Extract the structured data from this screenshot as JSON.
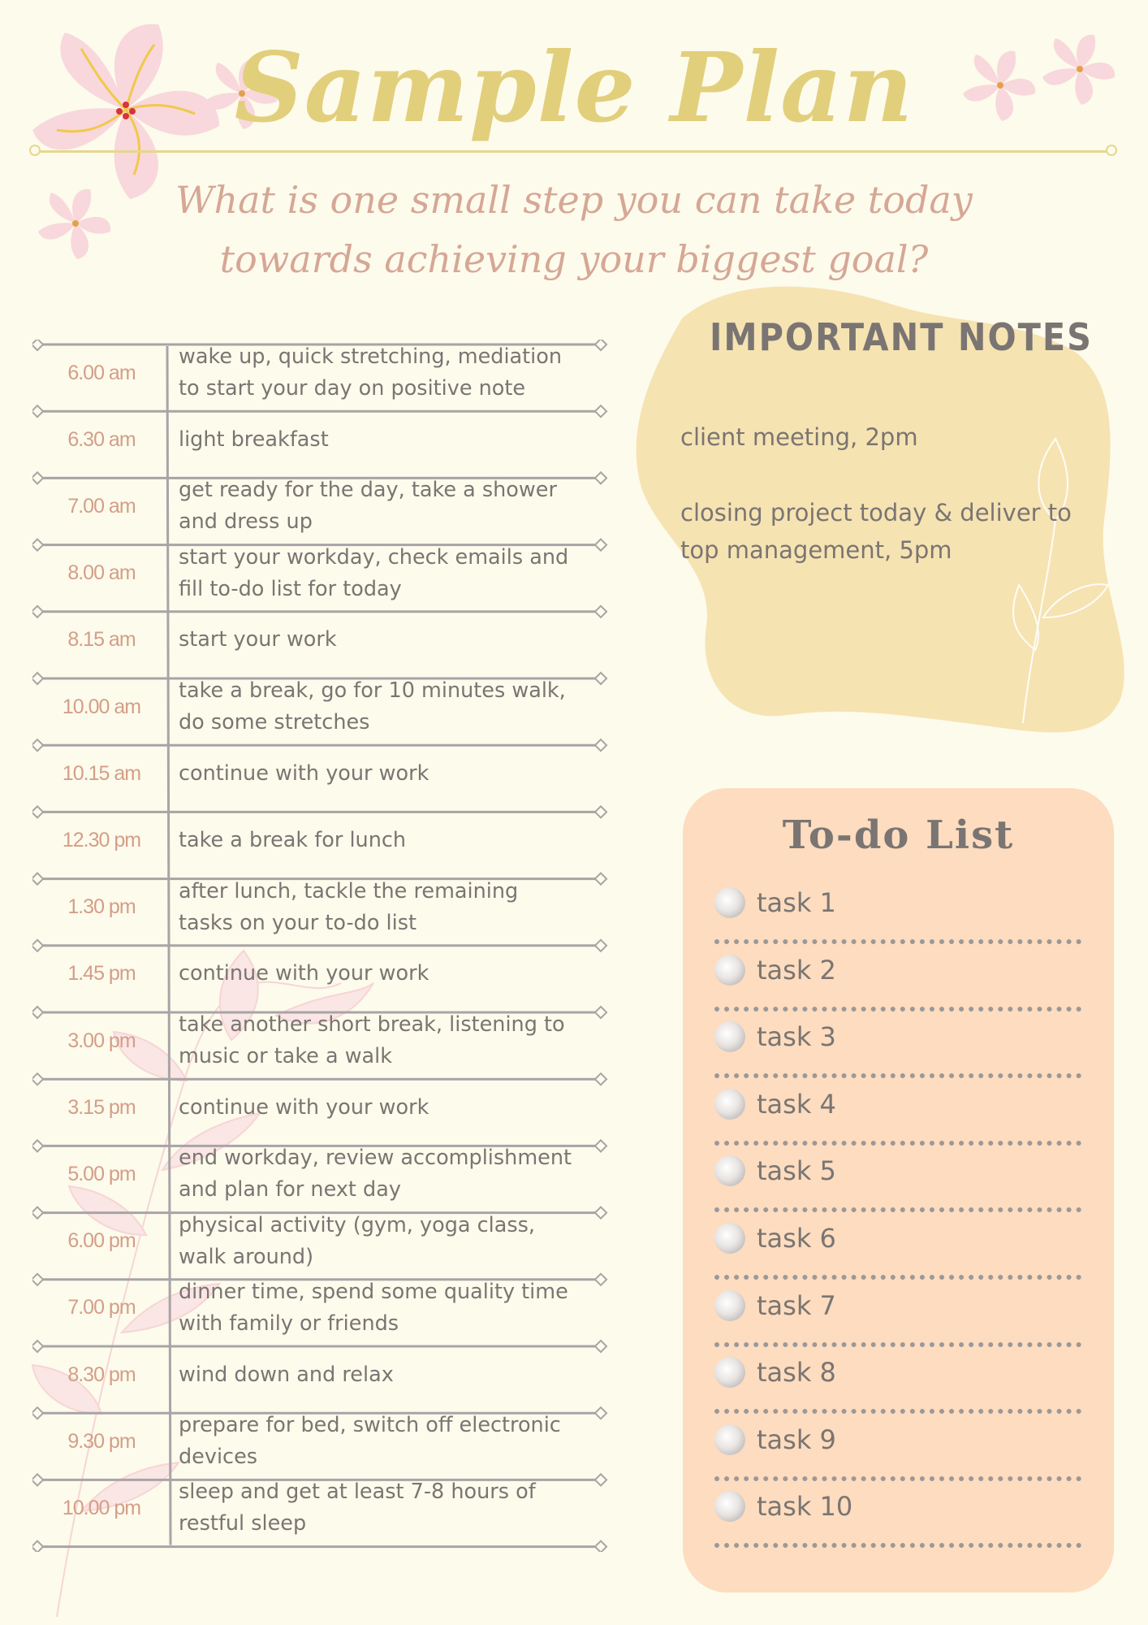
{
  "page": {
    "title": "Sample Plan",
    "question": "What is one small step you can take today towards achieving your biggest goal?"
  },
  "colors": {
    "background": "#fdfbec",
    "title": "#e2cf7c",
    "question": "#d6a796",
    "time": "#d49e88",
    "body_text": "#7a7572",
    "notes_blob": "#f6e3b2",
    "todo_card": "#fddcbf",
    "flower": "#f8d8dc",
    "flower_center": "#f0c94a"
  },
  "schedule": [
    {
      "time": "6.00 am",
      "task": "wake up, quick stretching, mediation\nto start your day on positive note"
    },
    {
      "time": "6.30 am",
      "task": "light breakfast"
    },
    {
      "time": "7.00 am",
      "task": "get ready for the day, take a shower\nand dress up"
    },
    {
      "time": "8.00 am",
      "task": "start your workday, check emails and\nfill to-do list for today"
    },
    {
      "time": "8.15 am",
      "task": "start your work"
    },
    {
      "time": "10.00 am",
      "task": "take a break, go for 10 minutes walk,\ndo some stretches"
    },
    {
      "time": "10.15 am",
      "task": "continue with your work"
    },
    {
      "time": "12.30 pm",
      "task": "take a break for lunch"
    },
    {
      "time": "1.30 pm",
      "task": "after lunch, tackle the remaining\ntasks on your to-do list"
    },
    {
      "time": "1.45 pm",
      "task": "continue with your work"
    },
    {
      "time": "3.00 pm",
      "task": "take another short break, listening to\nmusic or take a walk"
    },
    {
      "time": "3.15 pm",
      "task": "continue with your work"
    },
    {
      "time": "5.00 pm",
      "task": "end workday, review accomplishment\nand plan for next day"
    },
    {
      "time": "6.00 pm",
      "task": "physical activity (gym, yoga class,\nwalk around)"
    },
    {
      "time": "7.00 pm",
      "task": "dinner time, spend some quality time\nwith family or friends"
    },
    {
      "time": "8.30 pm",
      "task": "wind down and relax"
    },
    {
      "time": "9.30 pm",
      "task": "prepare for bed, switch off electronic\ndevices"
    },
    {
      "time": "10.00 pm",
      "task": "sleep and get at least 7-8 hours of\nrestful sleep"
    }
  ],
  "notes": {
    "title": "IMPORTANT NOTES",
    "items": [
      "client meeting, 2pm",
      "closing project today & deliver to top management, 5pm"
    ]
  },
  "todo": {
    "title": "To-do List",
    "items": [
      "task 1",
      "task 2",
      "task 3",
      "task 4",
      "task 5",
      "task 6",
      "task 7",
      "task 8",
      "task 9",
      "task 10"
    ]
  }
}
